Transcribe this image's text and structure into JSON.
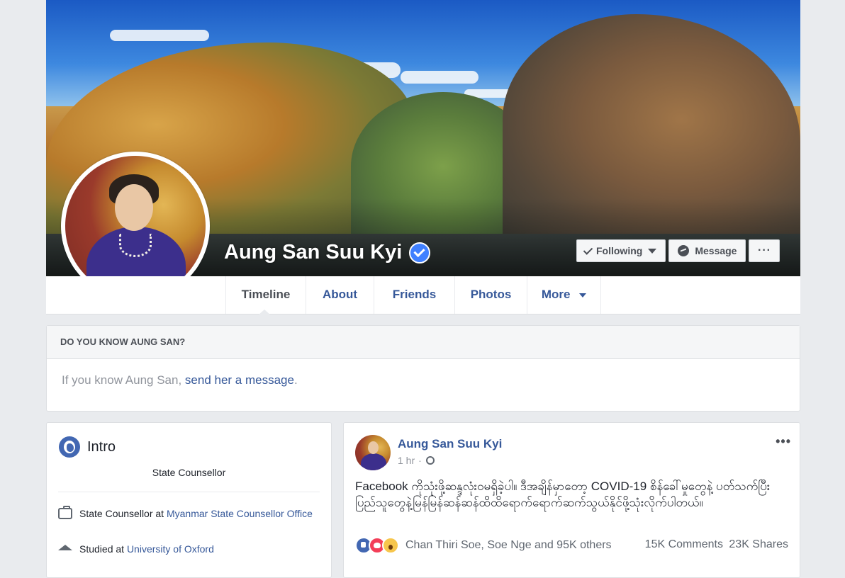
{
  "profile": {
    "name": "Aung San Suu Kyi"
  },
  "cover_buttons": {
    "following": "Following",
    "message": "Message",
    "more": "···"
  },
  "tabs": [
    "Timeline",
    "About",
    "Friends",
    "Photos",
    "More"
  ],
  "know": {
    "heading": "DO YOU KNOW AUNG SAN?",
    "prefix": "If you know Aung San, ",
    "link": "send her a message",
    "suffix": "."
  },
  "intro": {
    "title": "Intro",
    "bio": "State Counsellor",
    "work_prefix": "State Counsellor at ",
    "work_link": "Myanmar State Counsellor Office",
    "study_prefix": "Studied at ",
    "study_link": "University of Oxford"
  },
  "post": {
    "author": "Aung San Suu Kyi",
    "time": "1 hr",
    "separator": "·",
    "more": "•••",
    "text": "Facebook ကိုသုံးဖို့ဆန္ဒလုံးဝမရှိခဲ့ပါ။ ဒီအချိန်မှာတော့ COVID-19 စိန်ခေါ်မှုတွေနဲ့ ပတ်သက်ပြီးပြည်သူတွေနဲ့မြန်မြန်ဆန်ဆန်ထိထိရောက်ရောက်ဆက်သွယ်နိုင်ဖို့သုံးလိုက်ပါတယ်။",
    "reactions_names": "Chan Thiri Soe, Soe Nge and 95K others",
    "comments": "15K Comments",
    "shares": "23K Shares"
  },
  "colors": {
    "link": "#365899",
    "background": "#e9ebee",
    "verified": "#4080ff"
  }
}
